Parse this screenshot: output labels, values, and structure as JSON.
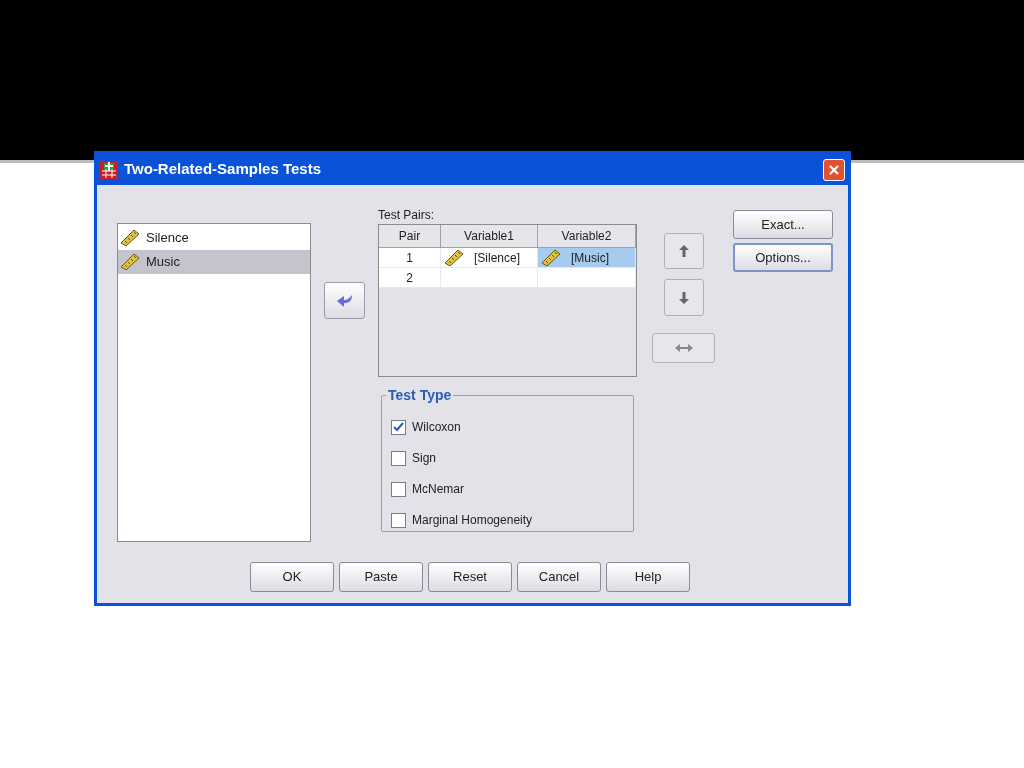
{
  "window": {
    "title": "Two-Related-Samples Tests"
  },
  "variables": [
    {
      "name": "Silence",
      "selected": false
    },
    {
      "name": "Music",
      "selected": true
    }
  ],
  "test_pairs": {
    "label": "Test Pairs:",
    "columns": [
      "Pair",
      "Variable1",
      "Variable2"
    ],
    "rows": [
      {
        "cells": [
          {
            "text": "1",
            "selected": false
          },
          {
            "text": "[Silence]",
            "selected": false
          },
          {
            "text": "[Music]",
            "selected": true
          }
        ]
      },
      {
        "cells": [
          {
            "text": "2",
            "selected": false
          },
          {
            "text": "",
            "selected": false
          },
          {
            "text": "",
            "selected": false
          }
        ]
      }
    ]
  },
  "side_buttons": [
    "Exact...",
    "Options..."
  ],
  "test_type": {
    "title": "Test Type",
    "options": [
      {
        "label": "Wilcoxon",
        "checked": true
      },
      {
        "label": "Sign",
        "checked": false
      },
      {
        "label": "McNemar",
        "checked": false
      },
      {
        "label": "Marginal Homogeneity",
        "checked": false
      }
    ]
  },
  "buttons": [
    "OK",
    "Paste",
    "Reset",
    "Cancel",
    "Help"
  ]
}
